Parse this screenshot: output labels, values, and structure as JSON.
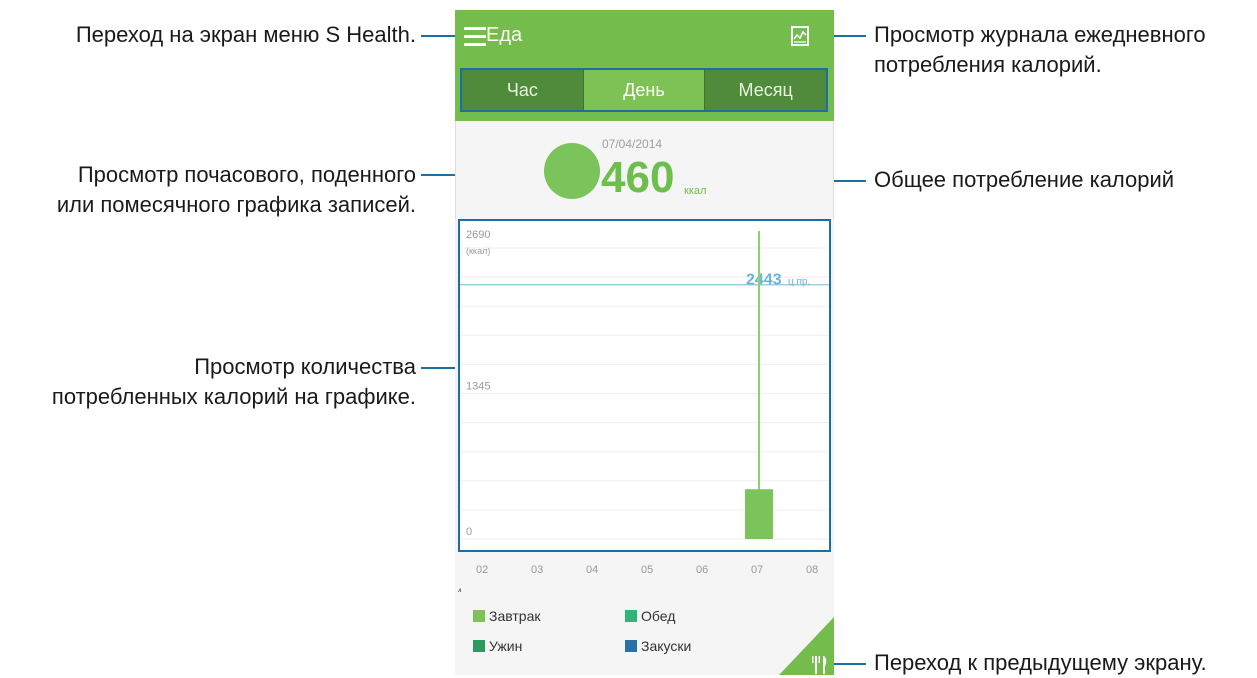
{
  "callouts": {
    "menu": "Переход на экран меню S Health.",
    "log_line1": "Просмотр журнала ежедневного",
    "log_line2": "потребления калорий.",
    "period_line1": "Просмотр почасового, поденного",
    "period_line2": "или помесячного графика записей.",
    "total": "Общее потребление калорий",
    "chart_line1": "Просмотр количества",
    "chart_line2": "потребленных калорий на графике.",
    "back": "Переход к предыдущему экрану."
  },
  "app": {
    "title": "Еда",
    "tabs": [
      "Час",
      "День",
      "Месяц"
    ],
    "active_tab": "День",
    "date": "07/04/2014",
    "calories": "460",
    "calories_unit": "ккал"
  },
  "chart_data": {
    "type": "bar",
    "categories": [
      "02",
      "03",
      "04",
      "05",
      "06",
      "07",
      "08"
    ],
    "values": [
      0,
      0,
      0,
      0,
      0,
      460,
      0
    ],
    "ylim": [
      0,
      2690
    ],
    "y_ticks": [
      "2690",
      "1345",
      "0"
    ],
    "y_unit": "(ккал)",
    "target": 2443,
    "target_label": "2443",
    "target_unit": "ц.пр.",
    "x_marker": "4",
    "colors": {
      "bar": "#7bc45b",
      "target": "#9cd0e6"
    }
  },
  "legend": [
    {
      "label": "Завтрак",
      "color": "#7ec255"
    },
    {
      "label": "Обед",
      "color": "#2fb57a"
    },
    {
      "label": "Ужин",
      "color": "#2e9b5e"
    },
    {
      "label": "Закуски",
      "color": "#2a6fa6"
    }
  ]
}
